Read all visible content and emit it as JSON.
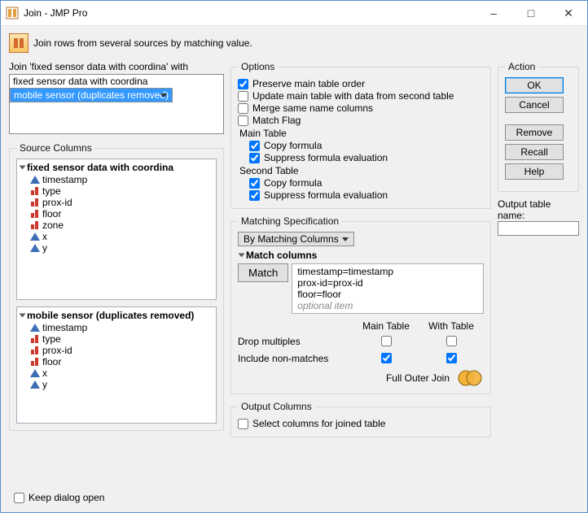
{
  "window": {
    "title": "Join - JMP Pro"
  },
  "hint": "Join rows from several sources by matching value.",
  "left": {
    "join_label": "Join 'fixed sensor data with coordina' with",
    "tables": [
      "fixed sensor data with coordina",
      "mobile sensor (duplicates removed)"
    ],
    "source_legend": "Source Columns",
    "src1": {
      "title": "fixed sensor data with coordina",
      "cols": [
        "timestamp",
        "type",
        "prox-id",
        "floor",
        "zone",
        "x",
        "y"
      ]
    },
    "src2": {
      "title": "mobile sensor (duplicates removed)",
      "cols": [
        "timestamp",
        "type",
        "prox-id",
        "floor",
        "x",
        "y"
      ]
    }
  },
  "mid": {
    "options_legend": "Options",
    "opts": [
      "Preserve main table order",
      "Update main table with data from second table",
      "Merge same name columns",
      "Match Flag"
    ],
    "main_label": "Main Table",
    "second_label": "Second Table",
    "copy": "Copy formula",
    "suppress": "Suppress formula evaluation",
    "match_legend": "Matching Specification",
    "match_mode": "By Matching Columns",
    "match_cols_label": "Match columns",
    "match_btn": "Match",
    "pairs": [
      "timestamp=timestamp",
      "prox-id=prox-id",
      "floor=floor"
    ],
    "optional": "optional item",
    "col_main": "Main Table",
    "col_with": "With Table",
    "drop": "Drop multiples",
    "incl": "Include non-matches",
    "join_type": "Full Outer Join",
    "out_legend": "Output Columns",
    "out_opt": "Select columns for joined table"
  },
  "right": {
    "action_legend": "Action",
    "ok": "OK",
    "cancel": "Cancel",
    "remove": "Remove",
    "recall": "Recall",
    "help": "Help",
    "output_label": "Output table name:",
    "output_value": ""
  },
  "keep": "Keep dialog open"
}
